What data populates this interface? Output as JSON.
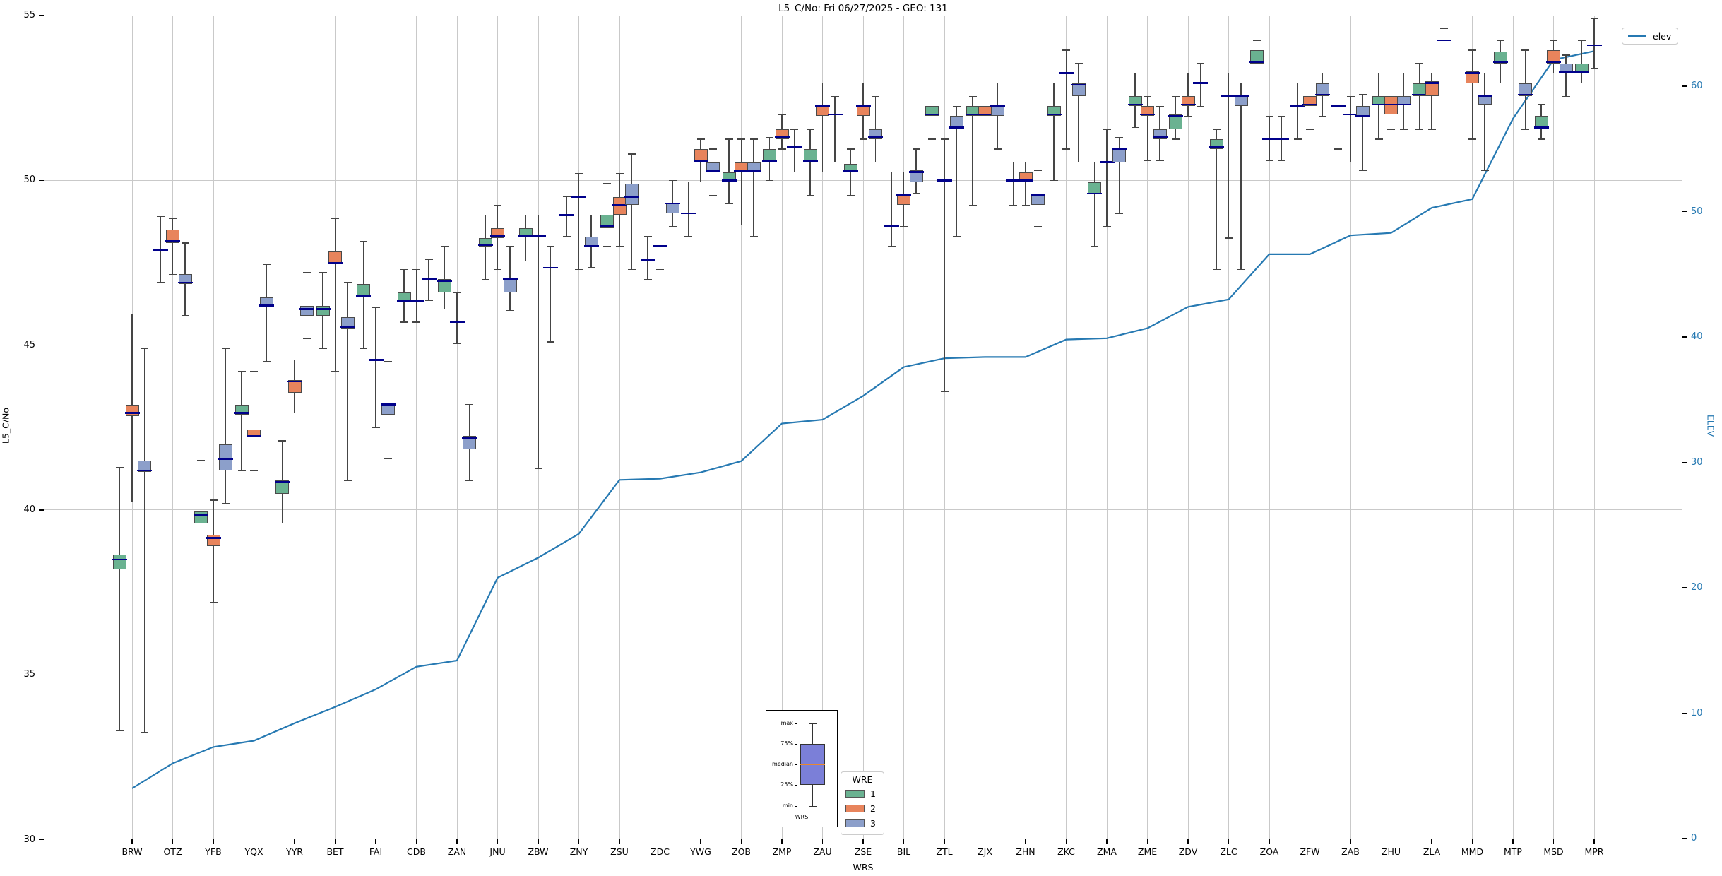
{
  "title": "L5_C/No: Fri 06/27/2025 - GEO: 131",
  "axes": {
    "ylabel": "L5_C/No",
    "xlabel": "WRS",
    "y2label": "ELEV",
    "ylim": [
      30,
      55
    ],
    "yticks": [
      30,
      35,
      40,
      45,
      50,
      55
    ],
    "grid_yticks": [
      35,
      40,
      45,
      50
    ],
    "y2ticks": [
      0,
      10,
      20,
      30,
      40,
      50,
      60
    ],
    "grid": true,
    "accent_color": "#2679b2"
  },
  "legend_wre": {
    "title": "WRE",
    "entries": [
      {
        "label": "1",
        "color": "#6ab291"
      },
      {
        "label": "2",
        "color": "#e8845c"
      },
      {
        "label": "3",
        "color": "#8c9fca"
      }
    ]
  },
  "legend_elev": {
    "label": "elev",
    "color": "#2679b2"
  },
  "inset": {
    "labels": [
      "max",
      "75%",
      "median",
      "25%",
      "min"
    ],
    "xlabel": "WRS",
    "box_color": "#7b7fd8",
    "median_color": "#e8872e"
  },
  "chart_data": {
    "type": "boxplot+line",
    "title": "L5_C/No: Fri 06/27/2025 - GEO: 131",
    "xlabel": "WRS",
    "ylabel": "L5_C/No",
    "y2label": "ELEV",
    "ylim": [
      30,
      55
    ],
    "y2lim": [
      0,
      66
    ],
    "legend_position": "lower center / upper right",
    "categories": [
      "BRW",
      "OTZ",
      "YFB",
      "YQX",
      "YYR",
      "BET",
      "FAI",
      "CDB",
      "ZAN",
      "JNU",
      "ZBW",
      "ZNY",
      "ZSU",
      "ZDC",
      "YWG",
      "ZOB",
      "ZMP",
      "ZAU",
      "ZSE",
      "BIL",
      "ZTL",
      "ZJX",
      "ZHN",
      "ZKC",
      "ZMA",
      "ZME",
      "ZDV",
      "ZLC",
      "ZOA",
      "ZFW",
      "ZAB",
      "ZHU",
      "ZLA",
      "MMD",
      "MTP",
      "MSD",
      "MPR"
    ],
    "line": {
      "name": "elev",
      "color": "#2679b2",
      "values": [
        4.0,
        6.0,
        7.3,
        7.8,
        9.2,
        10.5,
        11.9,
        13.7,
        14.2,
        20.8,
        22.4,
        24.3,
        28.6,
        28.7,
        29.2,
        30.1,
        33.1,
        33.4,
        35.3,
        37.6,
        38.3,
        38.4,
        38.4,
        39.8,
        39.9,
        40.7,
        42.4,
        43.0,
        46.6,
        46.6,
        48.1,
        48.3,
        50.3,
        51.0,
        57.4,
        62.1,
        62.8
      ]
    },
    "median_color": "#00008b",
    "series": [
      {
        "name": "1",
        "color": "#6ab291",
        "boxes": [
          [
            33.3,
            38.2,
            38.5,
            38.65,
            41.3
          ],
          [
            46.9,
            47.9,
            47.9,
            47.9,
            48.9
          ],
          [
            38.0,
            39.6,
            39.85,
            39.95,
            41.5
          ],
          [
            41.2,
            42.9,
            42.95,
            43.2,
            44.2
          ],
          [
            39.6,
            40.5,
            40.85,
            40.9,
            42.1
          ],
          [
            44.9,
            45.9,
            46.1,
            46.2,
            47.2
          ],
          [
            44.9,
            46.45,
            46.5,
            46.85,
            48.15
          ],
          [
            45.7,
            46.3,
            46.35,
            46.6,
            47.3
          ],
          [
            46.1,
            46.6,
            46.95,
            47.0,
            48.0
          ],
          [
            47.0,
            48.0,
            48.05,
            48.25,
            48.95
          ],
          [
            47.55,
            48.3,
            48.32,
            48.55,
            48.95
          ],
          [
            48.3,
            48.95,
            48.95,
            48.95,
            49.5
          ],
          [
            48.0,
            48.55,
            48.6,
            48.95,
            49.9
          ],
          [
            47.0,
            47.6,
            47.6,
            47.6,
            48.3
          ],
          [
            48.3,
            49.0,
            49.0,
            49.0,
            49.95
          ],
          [
            49.3,
            50.0,
            50.0,
            50.25,
            51.25
          ],
          [
            50.0,
            50.55,
            50.6,
            50.95,
            51.3
          ],
          [
            49.55,
            50.55,
            50.6,
            50.95,
            51.55
          ],
          [
            49.55,
            50.25,
            50.3,
            50.5,
            50.95
          ],
          [
            48.0,
            48.6,
            48.6,
            48.6,
            50.25
          ],
          [
            51.25,
            51.95,
            52.0,
            52.25,
            52.95
          ],
          [
            49.25,
            51.95,
            52.0,
            52.25,
            52.55
          ],
          [
            49.25,
            50.0,
            50.0,
            50.0,
            50.55
          ],
          [
            50.0,
            51.95,
            52.0,
            52.25,
            52.95
          ],
          [
            48.0,
            49.6,
            49.6,
            49.95,
            50.55
          ],
          [
            51.6,
            52.25,
            52.3,
            52.55,
            53.25
          ],
          [
            51.25,
            51.55,
            51.95,
            52.0,
            52.55
          ],
          [
            47.3,
            50.95,
            51.0,
            51.25,
            51.55
          ],
          [
            52.95,
            53.55,
            53.6,
            53.95,
            54.25
          ],
          [
            51.25,
            52.25,
            52.25,
            52.25,
            52.95
          ],
          [
            50.95,
            52.25,
            52.25,
            52.25,
            52.95
          ],
          [
            51.25,
            52.3,
            52.3,
            52.55,
            53.25
          ],
          [
            51.55,
            52.55,
            52.6,
            52.95,
            53.55
          ],
          null,
          [
            52.95,
            53.55,
            53.6,
            53.9,
            54.25
          ],
          [
            51.25,
            51.55,
            51.6,
            51.95,
            52.3
          ],
          [
            52.95,
            53.25,
            53.3,
            53.55,
            54.25
          ]
        ]
      },
      {
        "name": "2",
        "color": "#e8845c",
        "boxes": [
          [
            40.25,
            42.85,
            42.95,
            43.2,
            45.95
          ],
          [
            47.15,
            48.1,
            48.15,
            48.5,
            48.85
          ],
          [
            37.2,
            38.9,
            39.15,
            39.25,
            40.3
          ],
          [
            41.2,
            42.2,
            42.25,
            42.45,
            44.2
          ],
          [
            42.95,
            43.55,
            43.9,
            43.95,
            44.55
          ],
          [
            44.2,
            47.45,
            47.5,
            47.85,
            48.85
          ],
          [
            42.5,
            44.55,
            44.55,
            44.55,
            46.15
          ],
          [
            45.7,
            46.35,
            46.35,
            46.35,
            47.3
          ],
          [
            45.05,
            45.7,
            45.7,
            45.7,
            46.6
          ],
          [
            47.3,
            48.25,
            48.3,
            48.55,
            49.25
          ],
          [
            41.25,
            48.3,
            48.3,
            48.3,
            48.95
          ],
          [
            47.3,
            49.5,
            49.5,
            49.5,
            50.2
          ],
          [
            48.0,
            48.95,
            49.25,
            49.5,
            50.2
          ],
          [
            47.3,
            48.0,
            48.0,
            48.0,
            48.65
          ],
          [
            49.95,
            50.55,
            50.6,
            50.95,
            51.25
          ],
          [
            48.65,
            50.25,
            50.3,
            50.55,
            51.25
          ],
          [
            50.95,
            51.25,
            51.3,
            51.55,
            52.0
          ],
          [
            50.25,
            51.95,
            52.25,
            52.3,
            52.95
          ],
          [
            51.25,
            51.95,
            52.25,
            52.3,
            52.95
          ],
          [
            48.6,
            49.25,
            49.55,
            49.6,
            50.25
          ],
          [
            43.6,
            50.0,
            50.0,
            50.0,
            51.25
          ],
          [
            50.55,
            51.95,
            52.0,
            52.25,
            52.95
          ],
          [
            49.25,
            49.95,
            50.0,
            50.25,
            50.55
          ],
          [
            50.95,
            53.25,
            53.25,
            53.25,
            53.95
          ],
          [
            48.6,
            50.55,
            50.55,
            50.55,
            51.55
          ],
          [
            50.6,
            51.95,
            52.0,
            52.25,
            52.55
          ],
          [
            51.95,
            52.25,
            52.3,
            52.55,
            53.25
          ],
          [
            48.25,
            52.55,
            52.55,
            52.55,
            53.25
          ],
          [
            50.6,
            51.25,
            51.25,
            51.25,
            51.95
          ],
          [
            51.55,
            52.25,
            52.3,
            52.55,
            53.25
          ],
          [
            50.55,
            52.0,
            52.0,
            52.0,
            52.55
          ],
          [
            51.55,
            52.0,
            52.3,
            52.55,
            52.95
          ],
          [
            51.55,
            52.55,
            52.95,
            53.0,
            53.25
          ],
          [
            51.25,
            52.95,
            53.25,
            53.3,
            53.95
          ],
          null,
          [
            53.25,
            53.55,
            53.6,
            53.95,
            54.25
          ],
          [
            53.4,
            54.1,
            54.1,
            54.1,
            54.9
          ]
        ]
      },
      {
        "name": "3",
        "color": "#8c9fca",
        "boxes": [
          [
            33.25,
            41.15,
            41.2,
            41.5,
            44.9
          ],
          [
            45.9,
            46.85,
            46.9,
            47.15,
            48.1
          ],
          [
            40.2,
            41.2,
            41.55,
            42.0,
            44.9
          ],
          [
            44.5,
            46.15,
            46.2,
            46.45,
            47.45
          ],
          [
            45.2,
            45.9,
            46.1,
            46.2,
            47.2
          ],
          [
            40.9,
            45.5,
            45.55,
            45.85,
            46.9
          ],
          [
            41.55,
            42.9,
            43.2,
            43.25,
            44.5
          ],
          [
            46.35,
            47.0,
            47.0,
            47.0,
            47.6
          ],
          [
            40.9,
            41.85,
            42.2,
            42.25,
            43.2
          ],
          [
            46.05,
            46.6,
            47.0,
            47.0,
            48.0
          ],
          [
            45.1,
            47.35,
            47.35,
            47.35,
            48.0
          ],
          [
            47.35,
            48.0,
            48.0,
            48.3,
            48.95
          ],
          [
            47.3,
            49.25,
            49.5,
            49.9,
            50.8
          ],
          [
            48.6,
            49.0,
            49.3,
            49.3,
            50.0
          ],
          [
            49.55,
            50.25,
            50.3,
            50.55,
            50.95
          ],
          [
            48.3,
            50.25,
            50.3,
            50.55,
            51.25
          ],
          [
            50.25,
            51.0,
            51.0,
            51.0,
            51.55
          ],
          [
            50.55,
            52.0,
            52.0,
            52.0,
            52.55
          ],
          [
            50.55,
            51.25,
            51.3,
            51.55,
            52.55
          ],
          [
            49.6,
            49.95,
            50.25,
            50.3,
            50.95
          ],
          [
            48.3,
            51.55,
            51.6,
            51.95,
            52.25
          ],
          [
            50.95,
            51.95,
            52.25,
            52.3,
            52.95
          ],
          [
            48.6,
            49.25,
            49.55,
            49.6,
            50.3
          ],
          [
            50.55,
            52.55,
            52.9,
            52.95,
            53.55
          ],
          [
            49.0,
            50.55,
            50.95,
            51.0,
            51.3
          ],
          [
            50.6,
            51.25,
            51.3,
            51.55,
            52.25
          ],
          [
            52.25,
            52.95,
            52.95,
            52.95,
            53.55
          ],
          [
            47.3,
            52.25,
            52.55,
            52.6,
            52.95
          ],
          [
            50.6,
            51.25,
            51.25,
            51.25,
            51.95
          ],
          [
            51.95,
            52.55,
            52.6,
            52.95,
            53.25
          ],
          [
            50.3,
            51.95,
            51.95,
            52.25,
            52.6
          ],
          [
            51.55,
            52.3,
            52.3,
            52.55,
            53.25
          ],
          [
            52.95,
            54.25,
            54.25,
            54.25,
            54.6
          ],
          [
            50.3,
            52.3,
            52.55,
            52.6,
            53.25
          ],
          [
            51.55,
            52.55,
            52.6,
            52.95,
            53.95
          ],
          [
            52.55,
            53.25,
            53.3,
            53.55,
            53.8
          ],
          null
        ]
      }
    ]
  }
}
